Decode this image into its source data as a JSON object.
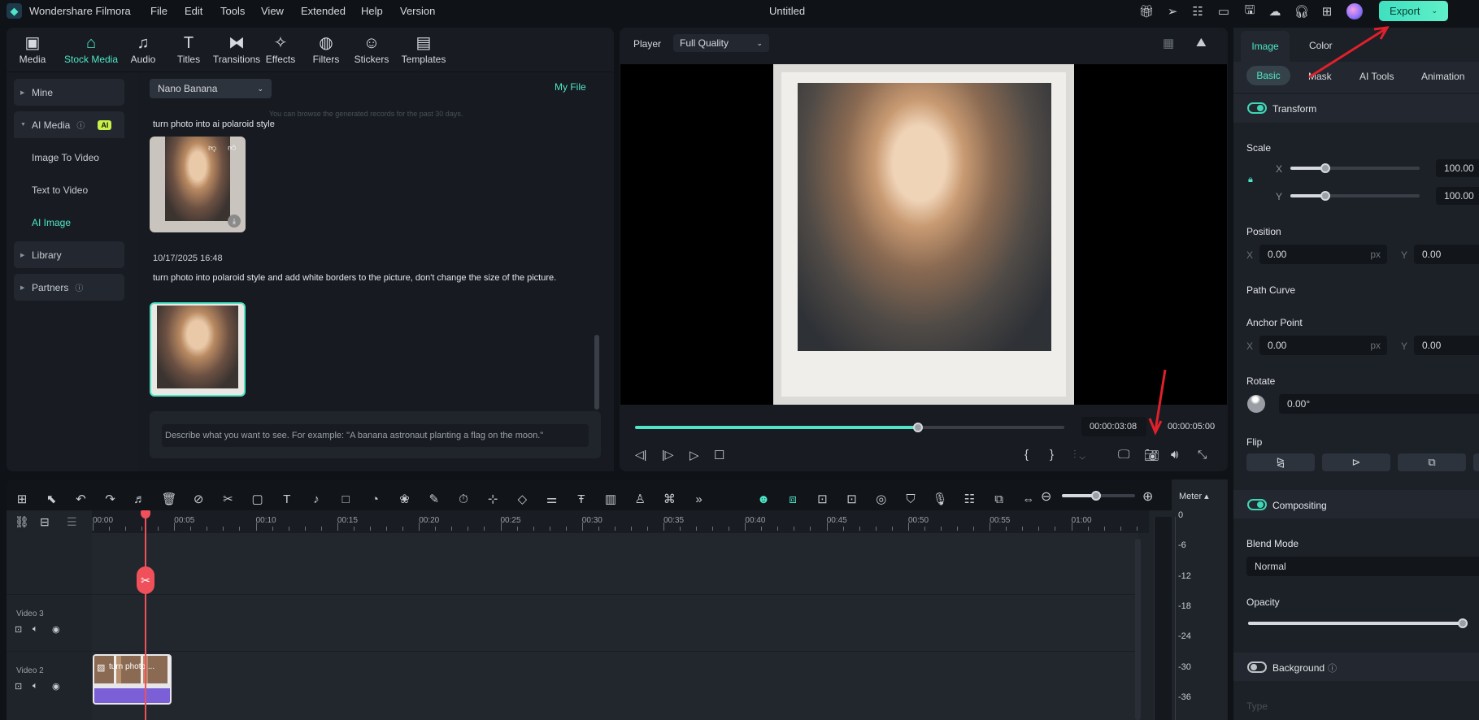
{
  "app": {
    "name": "Wondershare Filmora",
    "doc_title": "Untitled",
    "export_label": "Export"
  },
  "menu": [
    "File",
    "Edit",
    "Tools",
    "View",
    "Extended",
    "Help",
    "Version"
  ],
  "toolbar_tabs": [
    {
      "label": "Media",
      "icon": "media-icon"
    },
    {
      "label": "Stock Media",
      "icon": "stock-media-icon",
      "active": true
    },
    {
      "label": "Audio",
      "icon": "audio-icon"
    },
    {
      "label": "Titles",
      "icon": "titles-icon"
    },
    {
      "label": "Transitions",
      "icon": "transitions-icon"
    },
    {
      "label": "Effects",
      "icon": "effects-icon"
    },
    {
      "label": "Filters",
      "icon": "filters-icon"
    },
    {
      "label": "Stickers",
      "icon": "stickers-icon"
    },
    {
      "label": "Templates",
      "icon": "templates-icon"
    }
  ],
  "sidebar": {
    "mine": "Mine",
    "ai_media": "AI Media",
    "ai_badge": "AI",
    "image_to_video": "Image To Video",
    "text_to_video": "Text to Video",
    "ai_image": "AI Image",
    "library": "Library",
    "partners": "Partners"
  },
  "content": {
    "model_select": "Nano Banana",
    "my_file": "My File",
    "notice": "You can browse the generated records for the past 30 days.",
    "records": [
      {
        "prompt": "turn photo into ai polaroid style"
      },
      {
        "timestamp": "10/17/2025 16:48",
        "prompt": "turn photo into polaroid style and add white borders to the picture, don't change the size of the picture."
      }
    ],
    "prompt_placeholder": "Describe what you want to see. For example: \"A banana astronaut planting a flag on the moon.\""
  },
  "player": {
    "label": "Player",
    "quality": "Full Quality",
    "current_time": "00:00:03:08",
    "total_time": "00:00:05:00",
    "progress": 0.66
  },
  "inspector": {
    "tabs": [
      "Image",
      "Color"
    ],
    "subtabs": [
      "Basic",
      "Mask",
      "AI Tools",
      "Animation"
    ],
    "transform": "Transform",
    "scale": {
      "label": "Scale",
      "x": "100.00",
      "y": "100.00",
      "x_label": "X",
      "y_label": "Y",
      "fraction": 0.27
    },
    "position": {
      "label": "Position",
      "x": "0.00",
      "y": "0.00",
      "unit": "px"
    },
    "path_curve": "Path Curve",
    "anchor": {
      "label": "Anchor Point",
      "x": "0.00",
      "y": "0.00",
      "unit": "px"
    },
    "rotate": {
      "label": "Rotate",
      "value": "0.00°"
    },
    "flip": "Flip",
    "compositing": "Compositing",
    "blend_mode": {
      "label": "Blend Mode",
      "value": "Normal"
    },
    "opacity": {
      "label": "Opacity",
      "fraction": 1.0
    },
    "background": "Background",
    "type": "Type"
  },
  "timeline": {
    "ticks": [
      "00:00",
      "00:05",
      "00:10",
      "00:15",
      "00:20",
      "00:25",
      "00:30",
      "00:35",
      "00:40",
      "00:45",
      "00:50",
      "00:55",
      "01:00"
    ],
    "tracks": [
      "Video 3",
      "Video 2"
    ],
    "clip_label": "turn photo ...",
    "meter_label": "Meter",
    "meter_scale": [
      "0",
      "-6",
      "-12",
      "-18",
      "-24",
      "-30",
      "-36"
    ]
  },
  "colors": {
    "accent": "#3fd6b6",
    "playhead": "#f0505a",
    "clip": "#7a5fd6"
  }
}
